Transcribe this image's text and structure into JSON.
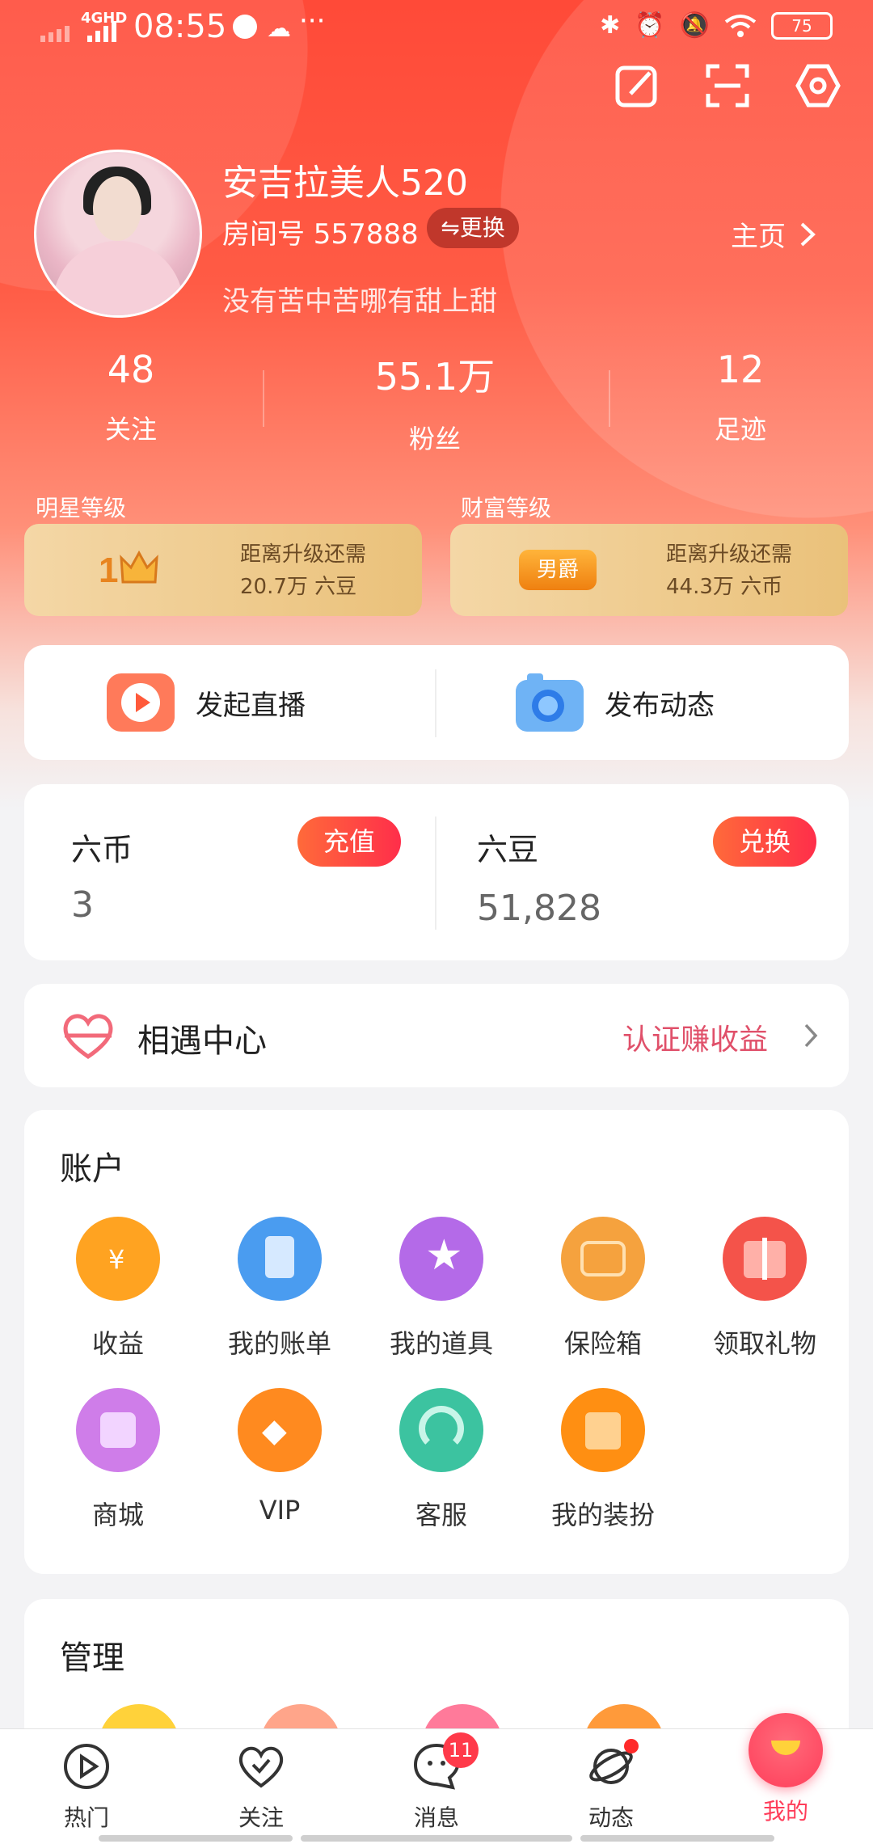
{
  "status_bar": {
    "network": "4GHD",
    "time": "08:55",
    "battery": "75"
  },
  "profile": {
    "name": "安吉拉美人520",
    "room_label": "房间号 557888",
    "change_button": "⇋更换",
    "bio": "没有苦中苦哪有甜上甜",
    "homepage_link": "主页"
  },
  "stats": [
    {
      "value": "48",
      "label": "关注"
    },
    {
      "value": "55.1万",
      "label": "粉丝"
    },
    {
      "value": "12",
      "label": "足迹"
    }
  ],
  "levels": {
    "star": {
      "title": "明星等级",
      "badge": "1",
      "req_line1": "距离升级还需",
      "req_line2": "20.7万 六豆"
    },
    "wealth": {
      "title": "财富等级",
      "badge": "男爵",
      "req_line1": "距离升级还需",
      "req_line2": "44.3万 六币"
    }
  },
  "actions": {
    "live": "发起直播",
    "post": "发布动态"
  },
  "wallet": {
    "coins": {
      "label": "六币",
      "value": "3",
      "button": "充值"
    },
    "beans": {
      "label": "六豆",
      "value": "51,828",
      "button": "兑换"
    }
  },
  "meet": {
    "title": "相遇中心",
    "link": "认证赚收益"
  },
  "account": {
    "title": "账户",
    "items": [
      {
        "label": "收益",
        "icon": "money-bag-icon",
        "color": "#ffa321"
      },
      {
        "label": "我的账单",
        "icon": "bill-icon",
        "color": "#4a9cf0"
      },
      {
        "label": "我的道具",
        "icon": "wand-icon",
        "color": "#b46ae8"
      },
      {
        "label": "保险箱",
        "icon": "safe-box-icon",
        "color": "#f5a23e"
      },
      {
        "label": "领取礼物",
        "icon": "gift-icon",
        "color": "#f4534a"
      },
      {
        "label": "商城",
        "icon": "shopping-bag-icon",
        "color": "#cf7de9"
      },
      {
        "label": "VIP",
        "icon": "vip-diamond-icon",
        "color": "#ff8a1f"
      },
      {
        "label": "客服",
        "icon": "headset-icon",
        "color": "#3cc3a0"
      },
      {
        "label": "我的装扮",
        "icon": "tshirt-icon",
        "color": "#ff8f12"
      }
    ]
  },
  "manage": {
    "title": "管理"
  },
  "nav": [
    {
      "label": "热门",
      "icon": "play-icon"
    },
    {
      "label": "关注",
      "icon": "heart-check-icon"
    },
    {
      "label": "消息",
      "icon": "message-icon",
      "badge": "11"
    },
    {
      "label": "动态",
      "icon": "planet-icon"
    },
    {
      "label": "我的",
      "icon": "profile-active-icon"
    }
  ]
}
